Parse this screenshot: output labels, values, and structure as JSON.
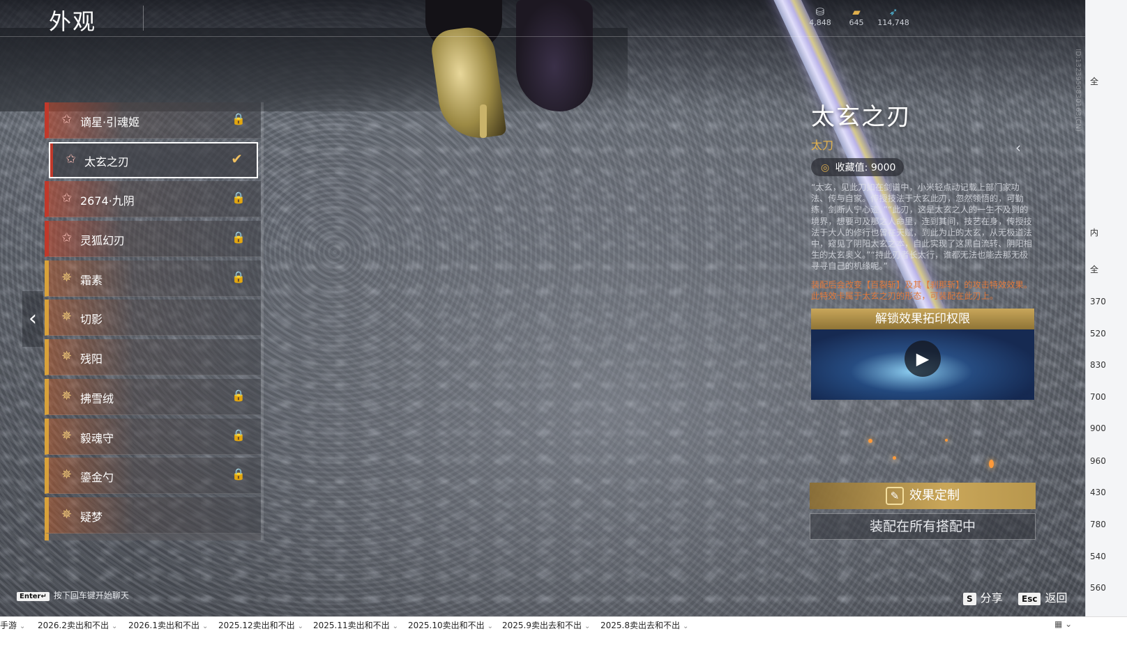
{
  "header": {
    "title": "外观"
  },
  "currencies": [
    {
      "icon": "coin-icon",
      "value": "4,848"
    },
    {
      "icon": "gold-bar-icon",
      "value": "645"
    },
    {
      "icon": "feather-icon",
      "value": "114,748"
    }
  ],
  "list": {
    "items": [
      {
        "name": "谪星·引魂姬",
        "rarity": "red",
        "state": "🔒"
      },
      {
        "name": "太玄之刃",
        "rarity": "red",
        "state": "✔"
      },
      {
        "name": "2674·九阴",
        "rarity": "red",
        "state": "🔒"
      },
      {
        "name": "灵狐幻刃",
        "rarity": "red",
        "state": "🔒"
      },
      {
        "name": "霜素",
        "rarity": "gold",
        "state": "🔒"
      },
      {
        "name": "切影",
        "rarity": "gold",
        "state": ""
      },
      {
        "name": "残阳",
        "rarity": "gold",
        "state": ""
      },
      {
        "name": "拂雪绒",
        "rarity": "gold",
        "state": "🔒"
      },
      {
        "name": "毅魂守",
        "rarity": "gold",
        "state": "🔒"
      },
      {
        "name": "鎏金勺",
        "rarity": "gold",
        "state": "🔒"
      },
      {
        "name": "疑梦",
        "rarity": "gold",
        "state": ""
      }
    ]
  },
  "detail": {
    "title": "太玄之刃",
    "type": "太刀",
    "collect_label": "收藏值: 9000",
    "description": "“太玄，见此刀如在剑谱中，小米轻点动记载上部门家功法、传与自家。传授技法于太玄此刃，忽然领悟的，可勤练，剑断人宁心迹。”“此刃，这是太玄之人的一生不及到的境界，想要可及那之人命里，连到其间，技艺在身，传授技法于大人的修行也曾在天赋，到此为止的太玄，从无极道法中，窥见了阴阳太玄之本，自此实现了这黑白流转、阴阳相生的太玄奥义。”“持此刃者长太行，谁都无法也能去那无极寻寻自己的机缘呢。”",
    "effect_note": "装配后会改变【百裂斩】及其【刹那斩】的攻击特效效果。此特效卡属于太玄之刃的形态，可装配在此刃上。",
    "unlock_header": "解锁效果拓印权限",
    "custom_button": "效果定制",
    "equip_button": "装配在所有搭配中",
    "build_id": "ID:1323950830163(CN)"
  },
  "hints": {
    "chat_key": "Enter↵",
    "chat_text": "按下回车键开始聊天",
    "share_key": "S",
    "share_label": "分享",
    "back_key": "Esc",
    "back_label": "返回"
  },
  "bookmarks": [
    "手游",
    "2026.2卖出和不出",
    "2026.1卖出和不出",
    "2025.12卖出和不出",
    "2025.11卖出和不出",
    "2025.10卖出和不出",
    "2025.9卖出去和不出",
    "2025.8卖出去和不出"
  ],
  "side_numbers": [
    "全",
    "内",
    "全",
    "370",
    "520",
    "830",
    "700",
    "900",
    "960",
    "430",
    "780",
    "540",
    "560"
  ],
  "colors": {
    "rarity_red": "#c0392b",
    "rarity_gold": "#d9a13a",
    "accent_gold": "#c9a659",
    "effect_orange": "#e0793c"
  }
}
